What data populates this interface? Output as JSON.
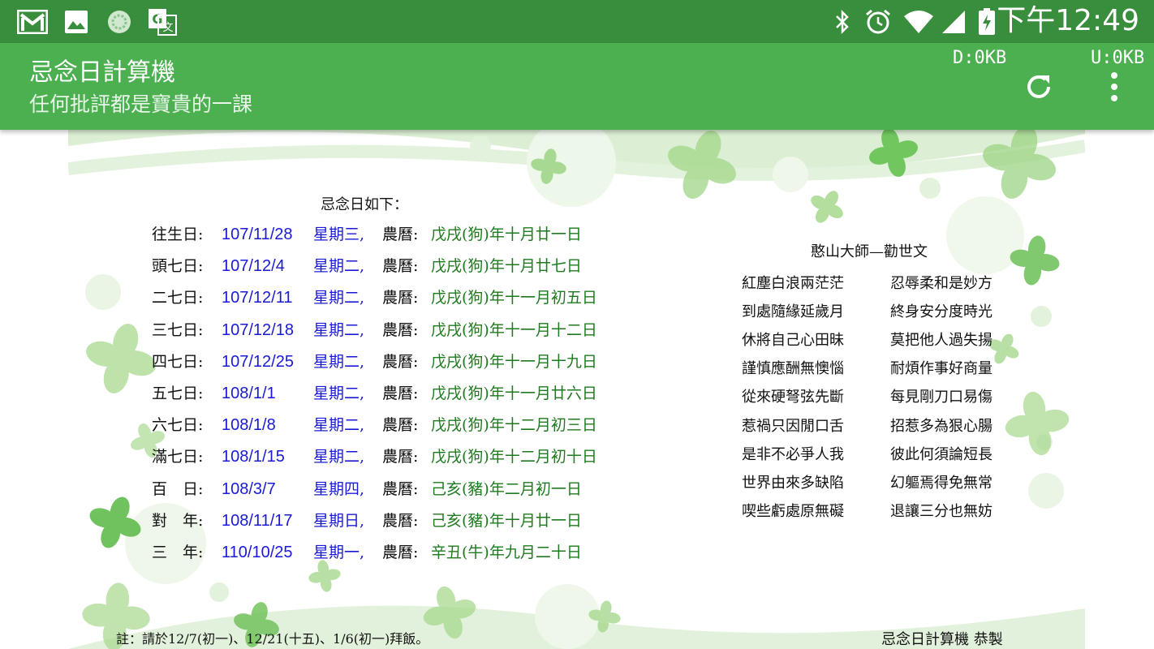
{
  "status_bar": {
    "time": "下午12:49",
    "left_icons": [
      "gmail-icon",
      "gallery-icon",
      "sync-app-icon",
      "translate-icon"
    ],
    "right_icons": [
      "bluetooth-icon",
      "alarm-icon",
      "wifi-icon",
      "signal-icon",
      "battery-charging-icon"
    ]
  },
  "app_bar": {
    "title": "忌念日計算機",
    "subtitle": "任何批評都是寶貴的一課",
    "download": "D:0KB",
    "upload": "U:0KB",
    "actions": [
      "refresh-icon",
      "more-vert-icon"
    ]
  },
  "card": {
    "heading": "忌念日如下：",
    "lunar_label": "農曆:",
    "rows": [
      {
        "label": "往生日:",
        "date": "107/11/28",
        "weekday": "星期三,",
        "lunar": "戊戌(狗)年十月廿一日"
      },
      {
        "label": "頭七日:",
        "date": "107/12/4",
        "weekday": "星期二,",
        "lunar": "戊戌(狗)年十月廿七日"
      },
      {
        "label": "二七日:",
        "date": "107/12/11",
        "weekday": "星期二,",
        "lunar": "戊戌(狗)年十一月初五日"
      },
      {
        "label": "三七日:",
        "date": "107/12/18",
        "weekday": "星期二,",
        "lunar": "戊戌(狗)年十一月十二日"
      },
      {
        "label": "四七日:",
        "date": "107/12/25",
        "weekday": "星期二,",
        "lunar": "戊戌(狗)年十一月十九日"
      },
      {
        "label": "五七日:",
        "date": "108/1/1",
        "weekday": "星期二,",
        "lunar": "戊戌(狗)年十一月廿六日"
      },
      {
        "label": "六七日:",
        "date": "108/1/8",
        "weekday": "星期二,",
        "lunar": "戊戌(狗)年十二月初三日"
      },
      {
        "label": "滿七日:",
        "date": "108/1/15",
        "weekday": "星期二,",
        "lunar": "戊戌(狗)年十二月初十日"
      },
      {
        "label": "百　日:",
        "date": "108/3/7",
        "weekday": "星期四,",
        "lunar": "己亥(豬)年二月初一日"
      },
      {
        "label": "對　年:",
        "date": "108/11/17",
        "weekday": "星期日,",
        "lunar": "己亥(豬)年十月廿一日"
      },
      {
        "label": "三　年:",
        "date": "110/10/25",
        "weekday": "星期一,",
        "lunar": "辛丑(牛)年九月二十日"
      }
    ],
    "poem": {
      "title": "憨山大師—勸世文",
      "left": [
        "紅塵白浪兩茫茫",
        "到處隨緣延歲月",
        "休將自己心田昧",
        "謹慎應酬無懊惱",
        "從來硬弩弦先斷",
        "惹禍只因閒口舌",
        "是非不必爭人我",
        "世界由來多缺陷",
        "喫些虧處原無礙"
      ],
      "right": [
        "忍辱柔和是妙方",
        "終身安分度時光",
        "莫把他人過失揚",
        "耐煩作事好商量",
        "每見剛刀口易傷",
        "招惹多為狠心腸",
        "彼此何須論短長",
        "幻軀焉得免無常",
        "退讓三分也無妨"
      ]
    },
    "note": "註：請於12/7(初一)、12/21(十五)、1/6(初一)拜飯。",
    "credit": "忌念日計算機 恭製"
  },
  "colors": {
    "status_bar": "#388e3c",
    "app_bar": "#4caf50",
    "date_text": "#1a1ad6",
    "lunar_text": "#1f7a1f"
  }
}
